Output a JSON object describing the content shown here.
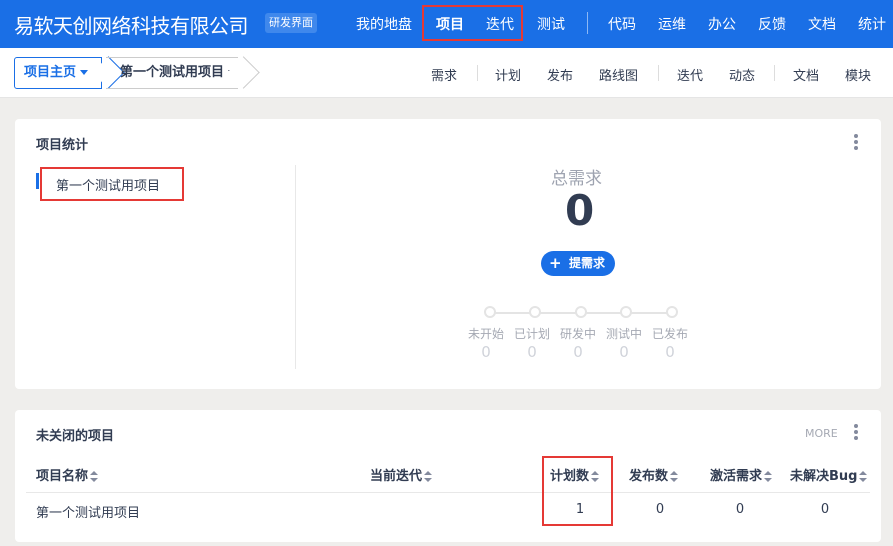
{
  "header": {
    "company": "易软天创网络科技有限公司",
    "badge": "研发界面",
    "nav": [
      "我的地盘",
      "项目",
      "迭代",
      "测试",
      "代码",
      "运维",
      "办公",
      "反馈",
      "文档",
      "统计"
    ]
  },
  "subnav": {
    "home_crumb": "项目主页",
    "project_crumb": "第一个测试用项目",
    "items": [
      "需求",
      "计划",
      "发布",
      "路线图",
      "迭代",
      "动态",
      "文档",
      "模块"
    ]
  },
  "stats_panel": {
    "title": "项目统计",
    "project_name": "第一个测试用项目",
    "total_label": "总需求",
    "total_value": "0",
    "add_button": "提需求",
    "steps": [
      {
        "label": "未开始",
        "count": "0"
      },
      {
        "label": "已计划",
        "count": "0"
      },
      {
        "label": "研发中",
        "count": "0"
      },
      {
        "label": "测试中",
        "count": "0"
      },
      {
        "label": "已发布",
        "count": "0"
      }
    ]
  },
  "open_projects": {
    "title": "未关闭的项目",
    "more": "MORE",
    "columns": [
      "项目名称",
      "当前迭代",
      "计划数",
      "发布数",
      "激活需求",
      "未解决Bug"
    ],
    "rows": [
      {
        "name": "第一个测试用项目",
        "iteration": "",
        "plans": "1",
        "releases": "0",
        "active_stories": "0",
        "open_bugs": "0"
      }
    ]
  },
  "colors": {
    "brand": "#1a6fe6",
    "highlight": "#e53935"
  }
}
